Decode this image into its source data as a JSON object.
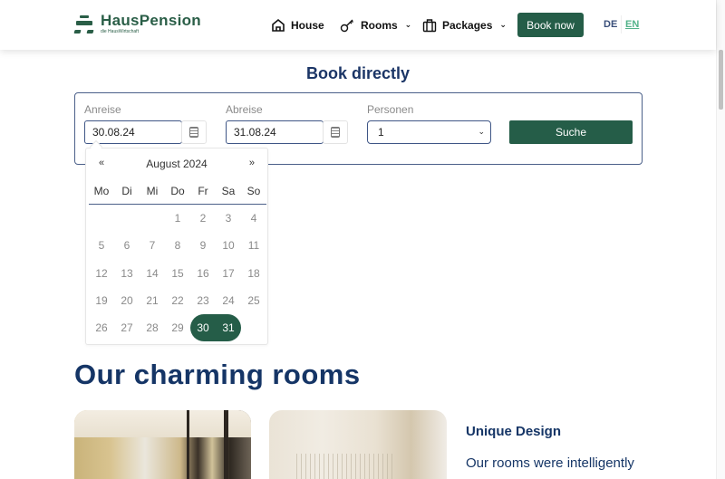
{
  "header": {
    "logo": {
      "name": "HausPension",
      "tagline": "die HausWirtschaft"
    },
    "nav": [
      {
        "label": "House",
        "icon": "house-icon",
        "has_dropdown": false
      },
      {
        "label": "Rooms",
        "icon": "key-icon",
        "has_dropdown": true
      },
      {
        "label": "Packages",
        "icon": "suitcase-icon",
        "has_dropdown": true
      }
    ],
    "chevron": "⌄",
    "book_now": "Book now",
    "languages": [
      {
        "code": "DE",
        "active": false
      },
      {
        "code": "EN",
        "active": true
      }
    ]
  },
  "booking": {
    "title": "Book directly",
    "arrival": {
      "label": "Anreise",
      "value": "30.08.24"
    },
    "departure": {
      "label": "Abreise",
      "value": "31.08.24"
    },
    "persons": {
      "label": "Personen",
      "value": "1"
    },
    "search_label": "Suche"
  },
  "calendar": {
    "prev": "«",
    "next": "»",
    "month_label": "August 2024",
    "weekdays": [
      "Mo",
      "Di",
      "Mi",
      "Do",
      "Fr",
      "Sa",
      "So"
    ],
    "weeks": [
      [
        "",
        "",
        "",
        "1",
        "2",
        "3",
        "4"
      ],
      [
        "5",
        "6",
        "7",
        "8",
        "9",
        "10",
        "11"
      ],
      [
        "12",
        "13",
        "14",
        "15",
        "16",
        "17",
        "18"
      ],
      [
        "19",
        "20",
        "21",
        "22",
        "23",
        "24",
        "25"
      ],
      [
        "26",
        "27",
        "28",
        "29",
        "30",
        "31",
        ""
      ]
    ],
    "selected_start": "30",
    "selected_end": "31"
  },
  "rooms": {
    "title": "Our charming rooms",
    "feature_title": "Unique Design",
    "feature_text": "Our rooms were intelligently"
  },
  "colors": {
    "brand_green": "#255d48",
    "navy": "#153566",
    "lang_active": "#53b38a"
  }
}
